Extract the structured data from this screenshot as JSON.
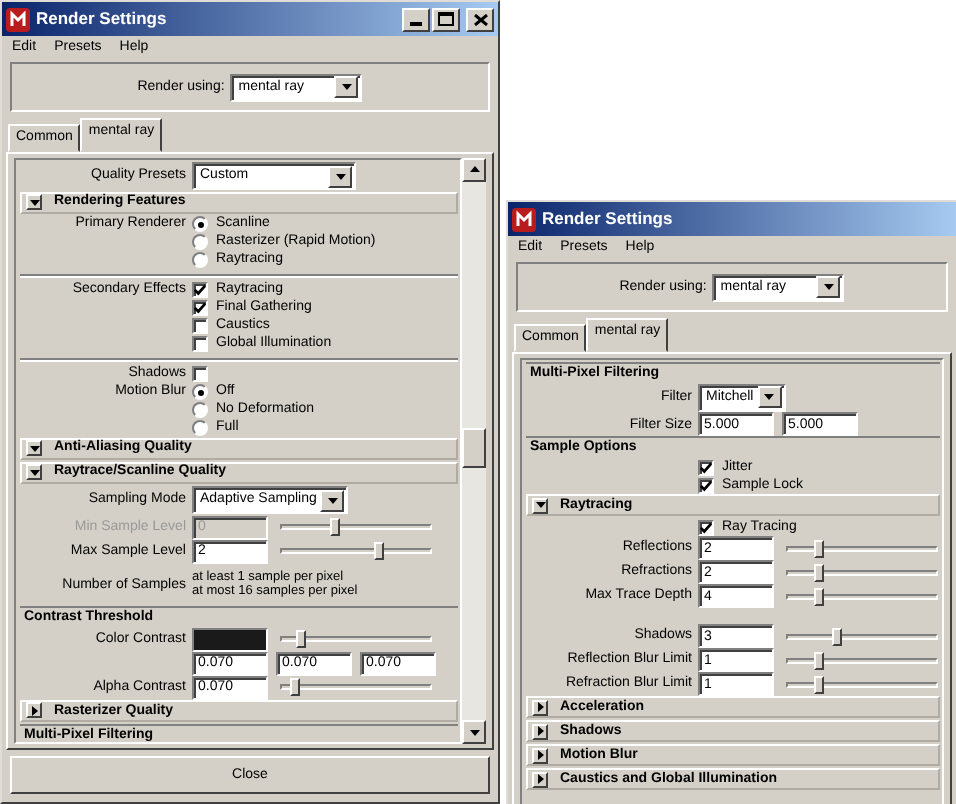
{
  "windows": [
    {
      "title": "Render Settings",
      "window_buttons": true,
      "scrollbar": true,
      "menu": [
        "Edit",
        "Presets",
        "Help"
      ],
      "render_using": {
        "label": "Render using:",
        "value": "mental ray"
      },
      "tabs": [
        {
          "label": "Common",
          "selected": false
        },
        {
          "label": "mental ray",
          "selected": true
        }
      ],
      "items": [
        {
          "kind": "dropdown",
          "label": "Quality Presets",
          "value": "Custom"
        },
        {
          "kind": "section",
          "title": "Rendering Features",
          "expanded": true,
          "items": [
            {
              "kind": "radios",
              "label": "Primary Renderer",
              "options": [
                {
                  "label": "Scanline",
                  "selected": true
                },
                {
                  "label": "Rasterizer (Rapid Motion)",
                  "selected": false
                },
                {
                  "label": "Raytracing",
                  "selected": false
                }
              ]
            },
            {
              "kind": "divider"
            },
            {
              "kind": "checks",
              "label": "Secondary Effects",
              "options": [
                {
                  "label": "Raytracing",
                  "checked": true
                },
                {
                  "label": "Final Gathering",
                  "checked": true
                },
                {
                  "label": "Caustics",
                  "checked": false
                },
                {
                  "label": "Global Illumination",
                  "checked": false
                }
              ]
            },
            {
              "kind": "divider"
            },
            {
              "kind": "checks",
              "label": "Shadows",
              "options": [
                {
                  "checked": false
                }
              ]
            },
            {
              "kind": "radios",
              "label": "Motion Blur",
              "options": [
                {
                  "label": "Off",
                  "selected": true
                },
                {
                  "label": "No Deformation",
                  "selected": false
                },
                {
                  "label": "Full",
                  "selected": false
                }
              ]
            }
          ]
        },
        {
          "kind": "section",
          "title": "Anti-Aliasing Quality",
          "expanded": true,
          "items": [
            {
              "kind": "section",
              "title": "Raytrace/Scanline Quality",
              "expanded": true,
              "items": [
                {
                  "kind": "dropdown",
                  "label": "Sampling Mode",
                  "value": "Adaptive Sampling"
                },
                {
                  "kind": "slider",
                  "label": "Min Sample Level",
                  "value": "0",
                  "level": 0.35,
                  "disabled": true
                },
                {
                  "kind": "slider",
                  "label": "Max Sample Level",
                  "value": "2",
                  "level": 0.65,
                  "disabled": false
                },
                {
                  "kind": "note",
                  "label": "Number of Samples",
                  "lines": [
                    "at least 1 sample per pixel",
                    "at most 16 samples per pixel"
                  ]
                },
                {
                  "kind": "group",
                  "title": "Contrast Threshold",
                  "items": [
                    {
                      "kind": "color",
                      "label": "Color Contrast",
                      "level": 0.12
                    },
                    {
                      "kind": "fields",
                      "values": [
                        "0.070",
                        "0.070",
                        "0.070"
                      ]
                    },
                    {
                      "kind": "slider",
                      "label": "Alpha Contrast",
                      "value": "0.070",
                      "level": 0.08,
                      "disabled": false
                    }
                  ]
                }
              ]
            },
            {
              "kind": "section",
              "title": "Rasterizer Quality",
              "expanded": false
            },
            {
              "kind": "group",
              "title": "Multi-Pixel Filtering"
            }
          ]
        }
      ],
      "close": "Close"
    },
    {
      "title": "Render Settings",
      "menu": [
        "Edit",
        "Presets",
        "Help"
      ],
      "render_using": {
        "label": "Render using:",
        "value": "mental ray"
      },
      "tabs": [
        {
          "label": "Common",
          "selected": false
        },
        {
          "label": "mental ray",
          "selected": true
        }
      ],
      "items": [
        {
          "kind": "group",
          "title": "Multi-Pixel Filtering",
          "items": [
            {
              "kind": "dropdown",
              "label": "Filter",
              "value": "Mitchell"
            },
            {
              "kind": "fields",
              "label": "Filter Size",
              "values": [
                "5.000",
                "5.000"
              ]
            }
          ]
        },
        {
          "kind": "group",
          "title": "Sample Options",
          "items": [
            {
              "kind": "checks",
              "options": [
                {
                  "label": "Jitter",
                  "checked": true
                },
                {
                  "label": "Sample Lock",
                  "checked": true
                }
              ]
            }
          ]
        },
        {
          "kind": "section",
          "title": "Raytracing",
          "expanded": true,
          "items": [
            {
              "kind": "checks",
              "options": [
                {
                  "label": "Ray Tracing",
                  "checked": true
                }
              ]
            },
            {
              "kind": "slider",
              "label": "Reflections",
              "value": "2",
              "level": 0.2,
              "disabled": false
            },
            {
              "kind": "slider",
              "label": "Refractions",
              "value": "2",
              "level": 0.2,
              "disabled": false
            },
            {
              "kind": "slider",
              "label": "Max Trace Depth",
              "value": "4",
              "level": 0.2,
              "disabled": false
            },
            {
              "kind": "spacer"
            },
            {
              "kind": "slider",
              "label": "Shadows",
              "value": "3",
              "level": 0.32,
              "disabled": false
            },
            {
              "kind": "slider",
              "label": "Reflection Blur Limit",
              "value": "1",
              "level": 0.2,
              "disabled": false
            },
            {
              "kind": "slider",
              "label": "Refraction Blur Limit",
              "value": "1",
              "level": 0.2,
              "disabled": false
            }
          ]
        },
        {
          "kind": "section",
          "title": "Acceleration",
          "expanded": false
        },
        {
          "kind": "section",
          "title": "Shadows",
          "expanded": false
        },
        {
          "kind": "section",
          "title": "Motion Blur",
          "expanded": false
        },
        {
          "kind": "section",
          "title": "Caustics and Global Illumination",
          "expanded": false
        }
      ]
    }
  ]
}
